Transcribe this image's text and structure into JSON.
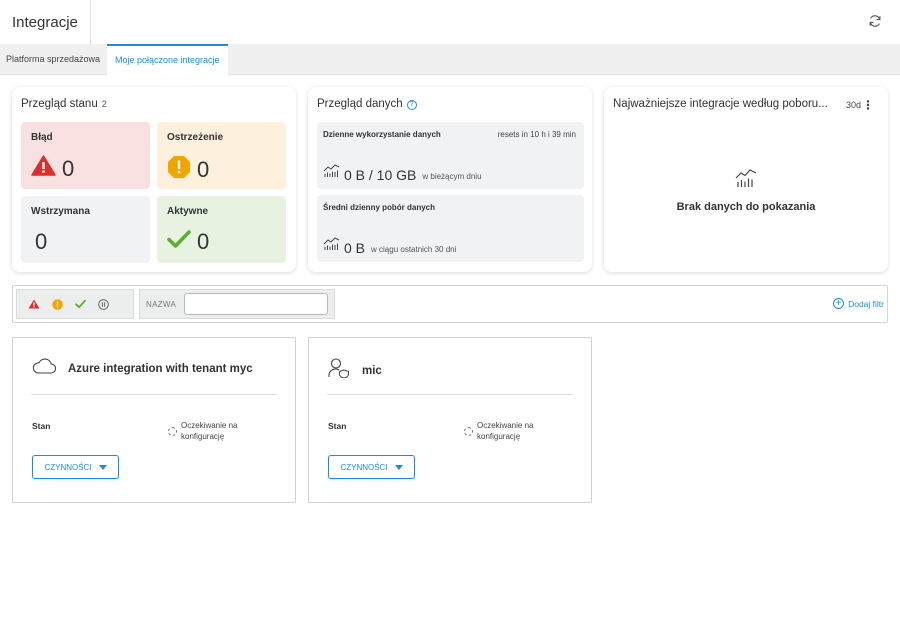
{
  "header": {
    "title": "Integracje",
    "refresh_icon": "refresh-icon"
  },
  "tabs": [
    {
      "label": "Platforma sprzedażowa",
      "active": false
    },
    {
      "label": "Moje połączone integracje",
      "active": true
    }
  ],
  "status": {
    "title": "Przegląd stanu",
    "count": "2",
    "items": [
      {
        "label": "Błąd",
        "value": "0",
        "icon": "error-triangle-icon",
        "color": "#d9302c"
      },
      {
        "label": "Ostrzeżenie",
        "value": "0",
        "icon": "warning-circle-icon",
        "color": "#f0a500"
      },
      {
        "label": "Wstrzymana",
        "value": "0",
        "icon": "",
        "color": "#f1f2f3"
      },
      {
        "label": "Aktywne",
        "value": "0",
        "icon": "checkmark-icon",
        "color": "#59b030"
      }
    ]
  },
  "data_overview": {
    "title": "Przegląd danych",
    "daily": {
      "label": "Dzienne wykorzystanie danych",
      "reset": "resets in 10 h i 39 min",
      "value": "0 B / 10 GB",
      "unit": "w bieżącym dniu"
    },
    "average": {
      "label": "Średni dzienny pobór danych",
      "value": "0 B",
      "unit": "w ciągu ostatnich 30 dni"
    }
  },
  "top_integrations": {
    "title": "Najważniejsze integracje według poboru...",
    "period": "30d",
    "empty_text": "Brak danych do pokazania"
  },
  "filter": {
    "name_label": "NAZWA",
    "name_value": "",
    "add_filter": "Dodaj filtr"
  },
  "integrations": [
    {
      "name": "Azure integration with tenant myc",
      "icon": "cloud-icon",
      "state_label": "Stan",
      "state_value_line1": "Oczekiwanie na",
      "state_value_line2": "konfigurację",
      "action": "CZYNNOŚCI"
    },
    {
      "name": "mic",
      "icon": "user-shield-icon",
      "state_label": "Stan",
      "state_value_line1": "Oczekiwanie na",
      "state_value_line2": "konfigurację",
      "action": "CZYNNOŚCI"
    }
  ],
  "colors": {
    "accent": "#1f8dd6",
    "error": "#d9302c",
    "warning": "#f0a500",
    "ok": "#59b030"
  }
}
